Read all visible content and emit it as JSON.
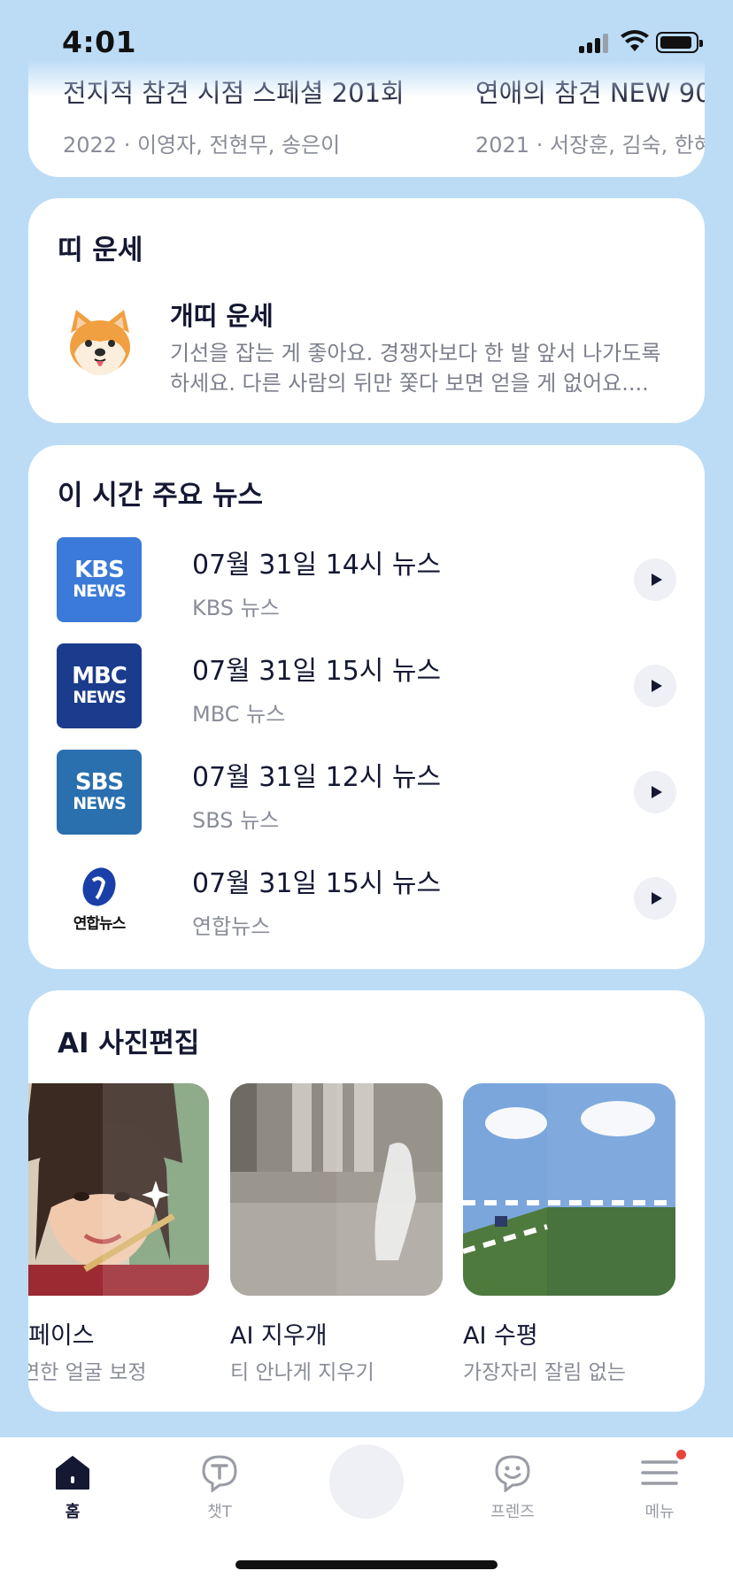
{
  "status_bar": {
    "time": "4:01"
  },
  "shows": [
    {
      "title": "전지적 참견 시점 스페셜 201회",
      "meta": "2022 · 이영자, 전현무, 송은이"
    },
    {
      "title": "연애의 참견 NEW 90",
      "meta": "2021 · 서장훈, 김숙, 한혜"
    }
  ],
  "fortune": {
    "section_title": "띠 운세",
    "name": "개띠 운세",
    "text": "기선을 잡는 게 좋아요. 경쟁자보다 한 발 앞서 나가도록 하세요. 다른 사람의 뒤만 쫓다 보면 얻을 게 없어요...."
  },
  "news": {
    "section_title": "이 시간 주요 뉴스",
    "items": [
      {
        "title": "07월 31일 14시 뉴스",
        "source": "KBS 뉴스",
        "logo_line1": "KBS",
        "logo_line2": "NEWS",
        "logo_color": "#3b7ad8"
      },
      {
        "title": "07월 31일 15시 뉴스",
        "source": "MBC 뉴스",
        "logo_line1": "MBC",
        "logo_line2": "NEWS",
        "logo_color": "#1b3c8c"
      },
      {
        "title": "07월 31일 12시 뉴스",
        "source": "SBS 뉴스",
        "logo_line1": "SBS",
        "logo_line2": "NEWS",
        "logo_color": "#2a6fae"
      },
      {
        "title": "07월 31일 15시 뉴스",
        "source": "연합뉴스",
        "logo_line1": "연합뉴스",
        "logo_color": "#1a3fa8"
      }
    ]
  },
  "photo_edit": {
    "section_title": "AI 사진편집",
    "items": [
      {
        "label": "페이스",
        "desc": "연한 얼굴 보정"
      },
      {
        "label": "AI 지우개",
        "desc": "티 안나게 지우기"
      },
      {
        "label": "AI 수평",
        "desc": "가장자리 잘림 없는"
      }
    ]
  },
  "tab_bar": {
    "tabs": [
      {
        "label": "홈",
        "icon": "home-icon",
        "active": true
      },
      {
        "label": "챗T",
        "icon": "chat-t-icon",
        "active": false
      },
      {
        "label": "",
        "icon": "center-button",
        "active": false
      },
      {
        "label": "프렌즈",
        "icon": "friends-icon",
        "active": false
      },
      {
        "label": "메뉴",
        "icon": "menu-icon",
        "active": false,
        "badge": true
      }
    ]
  },
  "colors": {
    "background": "#bcdcf6",
    "card": "#ffffff",
    "text_primary": "#141833",
    "text_secondary": "#8a8d99",
    "badge": "#e8453c"
  }
}
